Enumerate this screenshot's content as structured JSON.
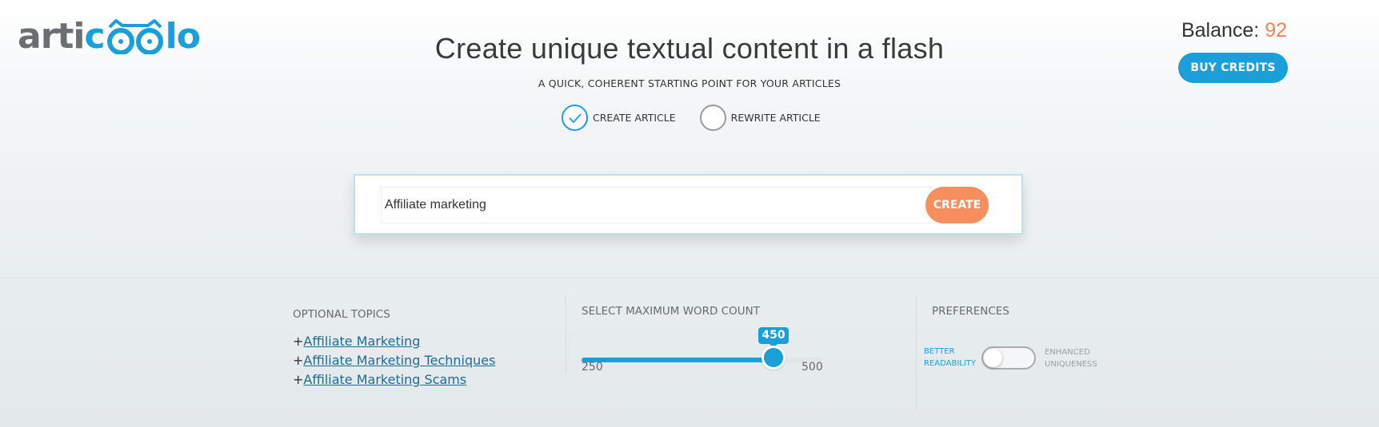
{
  "logo": {
    "part1": "arti",
    "part2": "c",
    "part3": "lo"
  },
  "header": {
    "title": "Create unique textual content in a flash",
    "subtitle": "A QUICK, COHERENT STARTING POINT FOR YOUR ARTICLES"
  },
  "modes": [
    {
      "label": "CREATE ARTICLE",
      "checked": true
    },
    {
      "label": "REWRITE ARTICLE",
      "checked": false
    }
  ],
  "account": {
    "balance_label": "Balance:",
    "balance_value": "92",
    "buy_label": "BUY CREDITS"
  },
  "search": {
    "value": "Affiliate marketing",
    "create_label": "CREATE"
  },
  "topics": {
    "title": "OPTIONAL TOPICS",
    "prefix": "+",
    "items": [
      "Affiliate Marketing",
      "Affiliate Marketing Techniques",
      "Affiliate Marketing Scams"
    ]
  },
  "word_count": {
    "title": "SELECT MAXIMUM WORD COUNT",
    "min": 250,
    "max": 500,
    "value": 450,
    "min_label": "250",
    "max_label": "500",
    "value_label": "450"
  },
  "preferences": {
    "title": "PREFERENCES",
    "left_line1": "BETTER",
    "left_line2": "READABILITY",
    "right_line1": "ENHANCED",
    "right_line2": "UNIQUENESS",
    "toggle_on": false
  },
  "colors": {
    "brand_blue": "#1a9fd9",
    "accent_orange": "#f68f5d",
    "logo_gray": "#6d6e71"
  }
}
